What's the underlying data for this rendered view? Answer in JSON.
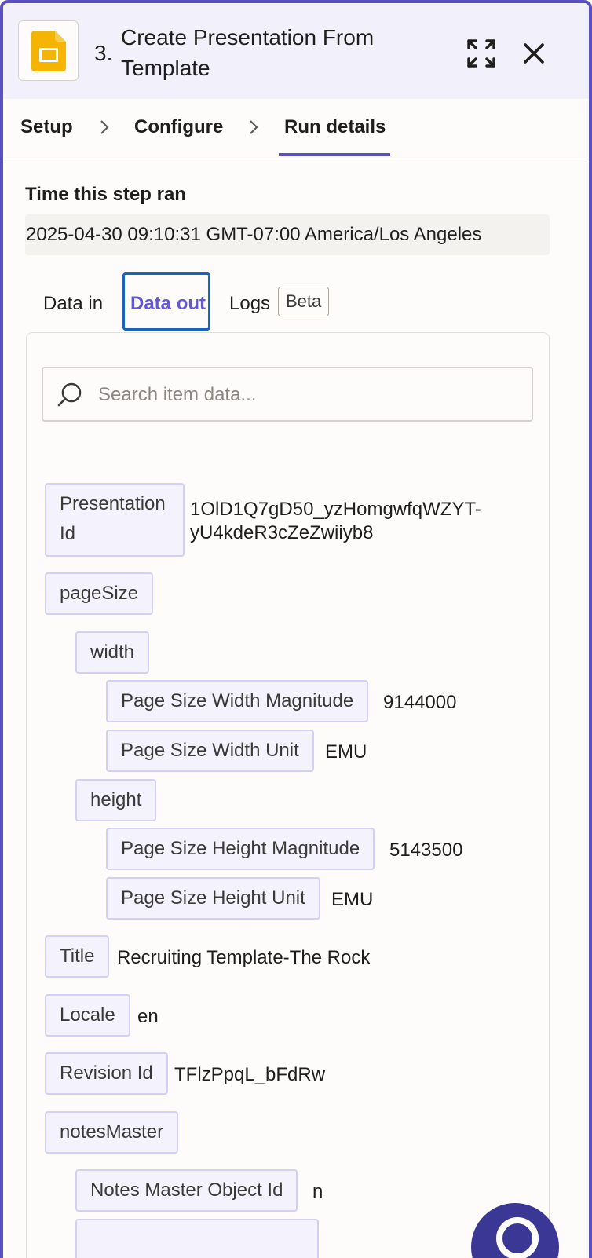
{
  "header": {
    "step_number": "3.",
    "title": "Create Presentation From Template",
    "app_icon": "google-slides-icon",
    "expand_icon": "expand-icon",
    "close_icon": "close-icon"
  },
  "tabs": {
    "items": [
      "Setup",
      "Configure",
      "Run details"
    ],
    "active": "Run details"
  },
  "run": {
    "label": "Time this step ran",
    "time": "2025-04-30 09:10:31 GMT-07:00 America/Los Angeles"
  },
  "subtabs": {
    "data_in": "Data in",
    "data_out": "Data out",
    "logs": "Logs",
    "beta": "Beta",
    "active": "Data out"
  },
  "search": {
    "placeholder": "Search item data...",
    "value": ""
  },
  "data": {
    "presentation_id": {
      "key": "Presentation Id",
      "value": "1OlD1Q7gD50_yzHomgwfqWZYT-yU4kdeR3cZeZwiiyb8"
    },
    "page_size": {
      "key": "pageSize"
    },
    "width": {
      "key": "width"
    },
    "width_magnitude": {
      "key": "Page Size Width Magnitude",
      "value": "9144000"
    },
    "width_unit": {
      "key": "Page Size Width Unit",
      "value": "EMU"
    },
    "height": {
      "key": "height"
    },
    "height_magnitude": {
      "key": "Page Size Height Magnitude",
      "value": "5143500"
    },
    "height_unit": {
      "key": "Page Size Height Unit",
      "value": "EMU"
    },
    "title": {
      "key": "Title",
      "value": "Recruiting Template-The Rock"
    },
    "locale": {
      "key": "Locale",
      "value": "en"
    },
    "revision_id": {
      "key": "Revision Id",
      "value": "TFlzPpqL_bFdRw"
    },
    "notes_master": {
      "key": "notesMaster"
    },
    "notes_master_object_id": {
      "key": "Notes Master Object Id",
      "value": "n"
    }
  },
  "colors": {
    "accent": "#5b4ec0",
    "active_subtab": "#6357d6",
    "focus_ring": "#1565c0",
    "key_bg": "#f3f2fd",
    "key_border": "#d3d0f4",
    "header_bg": "#f2f1fb",
    "help_button": "#3b3794"
  }
}
